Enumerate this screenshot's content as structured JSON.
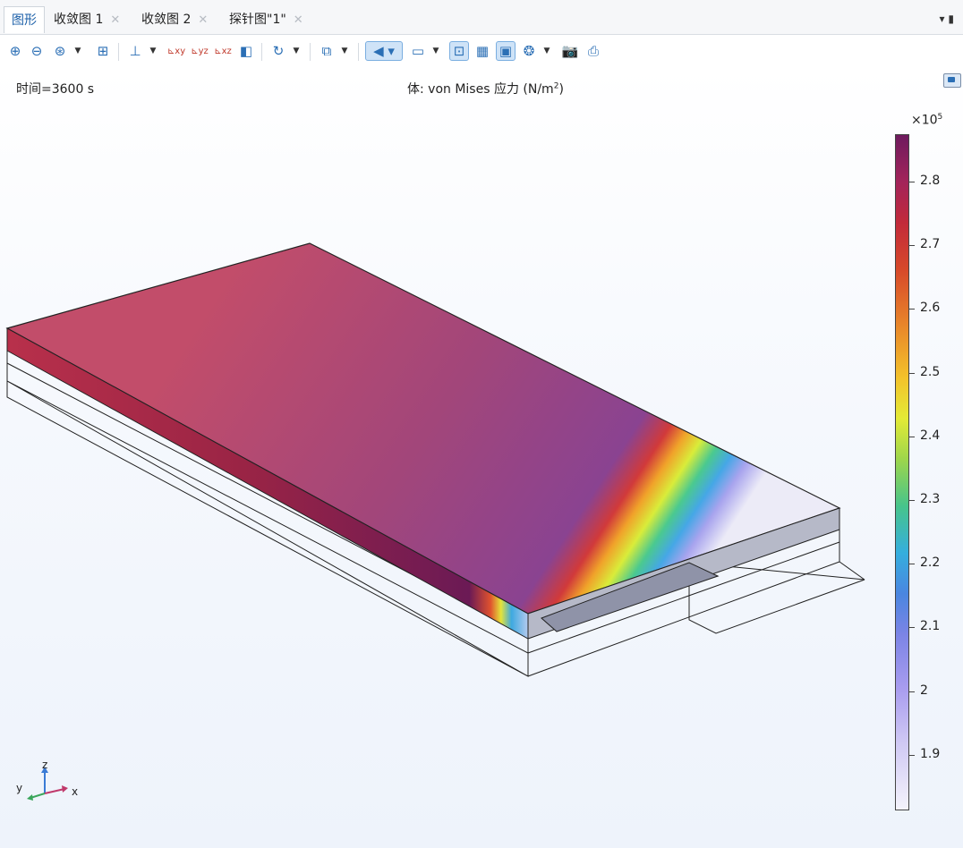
{
  "tabs": [
    {
      "label": "图形",
      "active": true,
      "closable": false
    },
    {
      "label": "收敛图 1",
      "active": false,
      "closable": true
    },
    {
      "label": "收敛图 2",
      "active": false,
      "closable": true
    },
    {
      "label": "探针图\"1\"",
      "active": false,
      "closable": true
    }
  ],
  "toolbar": {
    "icons": [
      "zoom-in-icon",
      "zoom-out-icon",
      "zoom-box-icon",
      "zoom-extents-icon",
      "axis-orient-icon",
      "view-xy-icon",
      "view-yz-icon",
      "view-xz-icon",
      "view-3d-icon",
      "rotate-icon",
      "select-icon",
      "light-icon",
      "transparency-icon",
      "wireframe-icon",
      "grid-icon",
      "scene-light-icon",
      "reset-icon",
      "camera-icon",
      "print-icon"
    ]
  },
  "plot": {
    "time_label": "时间=3600 s",
    "title_main": "体: von Mises 应力 (N/m",
    "title_sup": "2",
    "title_end": ")"
  },
  "colorbar": {
    "multiplier_base": "×10",
    "multiplier_exp": "5",
    "labels": [
      "2.8",
      "2.7",
      "2.6",
      "2.5",
      "2.4",
      "2.3",
      "2.2",
      "2.1",
      "2",
      "1.9"
    ],
    "gradient": [
      "#6e1b5e",
      "#c22a3a",
      "#e8842a",
      "#f3c22b",
      "#9ed64b",
      "#35aede",
      "#7b84e5",
      "#cfc8f4",
      "#f4f3fb"
    ]
  },
  "axes_triad": {
    "x": "x",
    "y": "y",
    "z": "z"
  }
}
